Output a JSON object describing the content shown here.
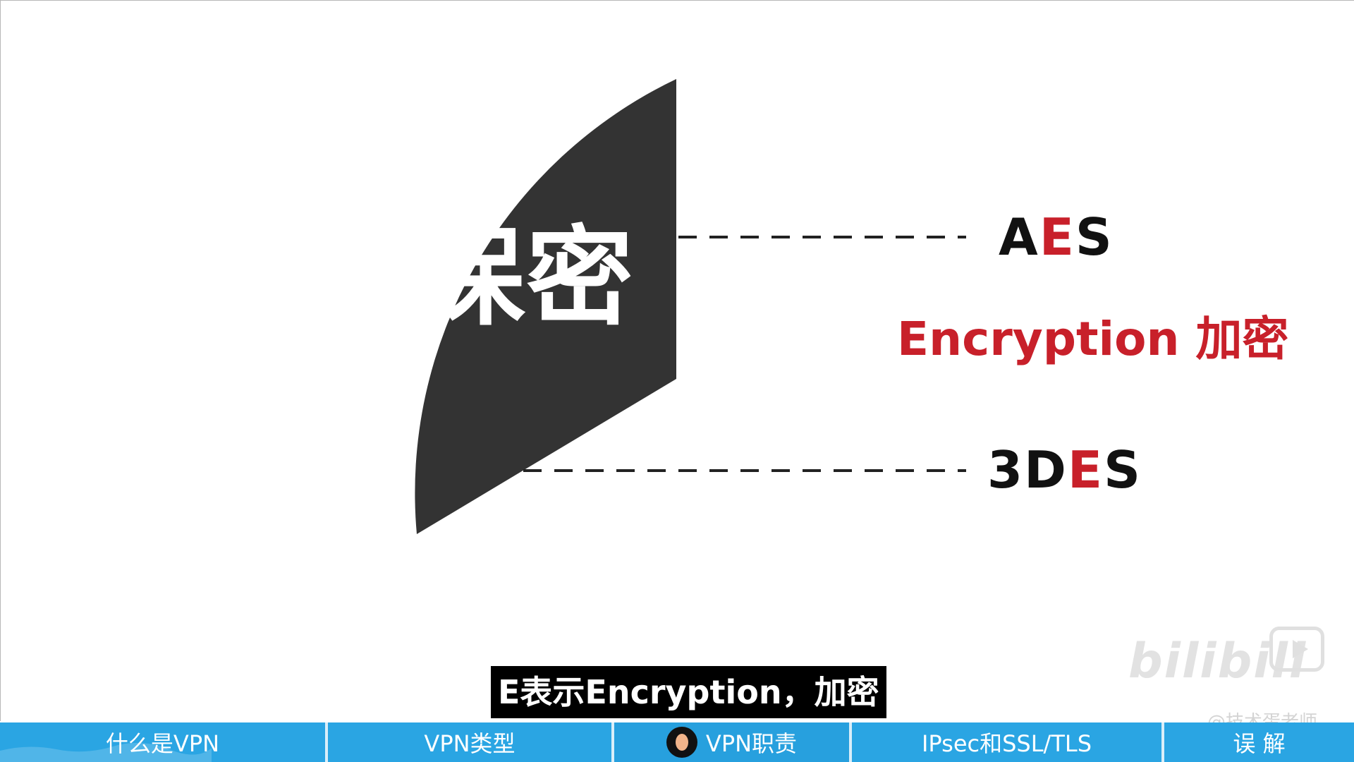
{
  "slide": {
    "center_label": "保密",
    "algorithms": [
      {
        "pre": "A",
        "hl": "E",
        "post": "S"
      },
      {
        "pre": "3D",
        "hl": "E",
        "post": "S"
      }
    ],
    "encryption_note": "Encryption 加密",
    "colors": {
      "shape": "#333333",
      "highlight": "#c8202a",
      "text": "#111111"
    }
  },
  "subtitle": "E表示Encryption，加密",
  "watermark": {
    "brand": "bilibili",
    "user": "@技术蛋老师",
    "icon": "tv-play-icon"
  },
  "chapters": [
    {
      "label": "什么是VPN"
    },
    {
      "label": "VPN类型"
    },
    {
      "label": "VPN职责",
      "icon": "presenter-avatar-icon"
    },
    {
      "label": "IPsec和SSL/TLS"
    },
    {
      "label": "误 解"
    }
  ],
  "colors": {
    "chapter_bar": "#2aa5e3",
    "chapter_divider": "#d9eef9"
  }
}
